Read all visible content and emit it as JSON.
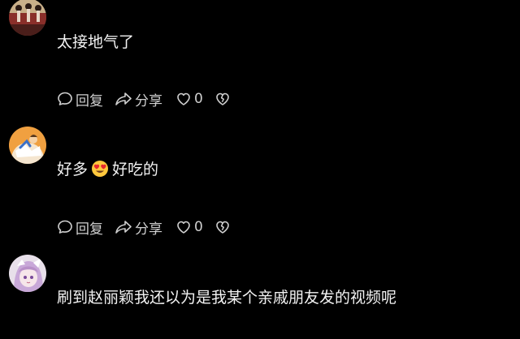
{
  "comments": [
    {
      "avatar_icon": "user-avatar-photo-stage",
      "text": "太接地气了",
      "actions": {
        "reply_label": "回复",
        "share_label": "分享",
        "like_count": "0"
      }
    },
    {
      "avatar_icon": "user-avatar-cartoon-orange",
      "text_before_emoji": "好多",
      "emoji_icon": "heart-eyes-emoji",
      "text_after_emoji": "好吃的",
      "actions": {
        "reply_label": "回复",
        "share_label": "分享",
        "like_count": "0"
      }
    },
    {
      "avatar_icon": "user-avatar-anime-girl",
      "text": "刷到赵丽颖我还以为是我某个亲戚朋友发的视频呢"
    }
  ],
  "colors": {
    "background": "#000000",
    "text": "#f2f2f2",
    "action_text": "#cfcfcf"
  }
}
